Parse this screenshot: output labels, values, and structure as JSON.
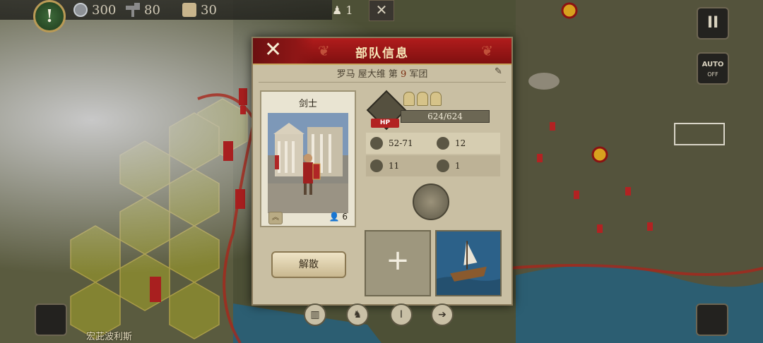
{
  "hud": {
    "alert_symbol": "!",
    "silver": "300",
    "hammer": "80",
    "scroll": "30",
    "army_count": "1",
    "cross_symbol": "✕"
  },
  "right_buttons": {
    "pause_symbol": "II",
    "auto_label": "AUTO",
    "auto_state": "OFF"
  },
  "dialog": {
    "title": "部队信息",
    "close_symbol": "✕",
    "subtitle_prefix": "罗马 屋大维 第",
    "subtitle_number": "9",
    "subtitle_suffix": "军团",
    "unit": {
      "name": "剑士",
      "count": "6"
    },
    "hp": {
      "label": "HP",
      "value": "624/624",
      "fraction": 1.0
    },
    "stats": [
      {
        "icon": "attack-icon",
        "value": "52-71"
      },
      {
        "icon": "armor-icon",
        "value": "12"
      },
      {
        "icon": "movement-icon",
        "value": "11"
      },
      {
        "icon": "vision-icon",
        "value": "1"
      }
    ],
    "disband_label": "解散",
    "add_symbol": "+"
  },
  "map": {
    "bottom_label": "宏茈波利斯"
  },
  "colors": {
    "header_red": "#a01818",
    "panel": "#c9bfa3",
    "hp_badge": "#b22222"
  }
}
